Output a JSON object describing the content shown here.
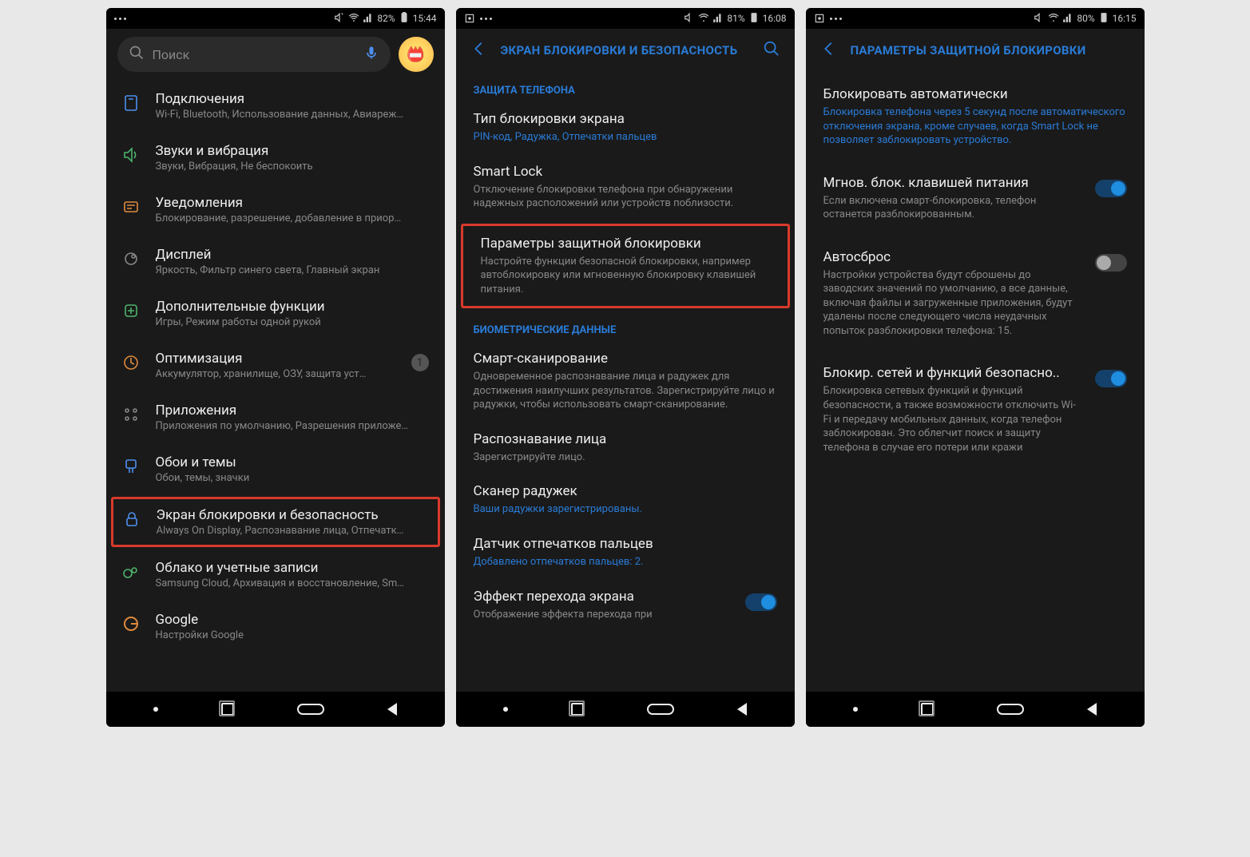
{
  "screen1": {
    "status": {
      "battery": "82%",
      "time": "15:44"
    },
    "search_placeholder": "Поиск",
    "items": [
      {
        "title": "Подключения",
        "sub": "Wi-Fi, Bluetooth, Использование данных, Авиареж…"
      },
      {
        "title": "Звуки и вибрация",
        "sub": "Звуки, Вибрация, Не беспокоить"
      },
      {
        "title": "Уведомления",
        "sub": "Блокирование, разрешение, добавление в приор…"
      },
      {
        "title": "Дисплей",
        "sub": "Яркость, Фильтр синего света, Главный экран"
      },
      {
        "title": "Дополнительные функции",
        "sub": "Игры, Режим работы одной рукой"
      },
      {
        "title": "Оптимизация",
        "sub": "Аккумулятор, хранилище, ОЗУ, защита уст…",
        "badge": "1"
      },
      {
        "title": "Приложения",
        "sub": "Приложения по умолчанию, Разрешения приложе…"
      },
      {
        "title": "Обои и темы",
        "sub": "Обои, темы, значки"
      },
      {
        "title": "Экран блокировки и безопасность",
        "sub": "Always On Display, Распознавание лица, Отпечатк…",
        "highlighted": true
      },
      {
        "title": "Облако и учетные записи",
        "sub": "Samsung Cloud, Архивация и восстановление, Sm…"
      },
      {
        "title": "Google",
        "sub": "Настройки Google"
      }
    ]
  },
  "screen2": {
    "status": {
      "battery": "81%",
      "time": "16:08"
    },
    "header": "ЭКРАН БЛОКИРОВКИ И БЕЗОПАСНОСТЬ",
    "section1": "ЗАЩИТА ТЕЛЕФОНА",
    "items1": [
      {
        "title": "Тип блокировки экрана",
        "sub": "PIN-код, Радужка, Отпечатки пальцев",
        "blue": true
      },
      {
        "title": "Smart Lock",
        "sub": "Отключение блокировки телефона при обнаружении надежных расположений или устройств поблизости."
      },
      {
        "title": "Параметры защитной блокировки",
        "sub": "Настройте функции безопасной блокировки, например автоблокировку или мгновенную блокировку клавишей питания.",
        "highlighted": true
      }
    ],
    "section2": "БИОМЕТРИЧЕСКИЕ ДАННЫЕ",
    "items2": [
      {
        "title": "Смарт-сканирование",
        "sub": "Одновременное распознавание лица и радужек для достижения наилучших результатов. Зарегистрируйте лицо и радужки, чтобы использовать смарт-сканирование."
      },
      {
        "title": "Распознавание лица",
        "sub": "Зарегистрируйте лицо."
      },
      {
        "title": "Сканер радужек",
        "sub": "Ваши радужки зарегистрированы.",
        "blue": true
      },
      {
        "title": "Датчик отпечатков пальцев",
        "sub": "Добавлено отпечатков пальцев: 2.",
        "blue": true
      },
      {
        "title": "Эффект перехода экрана",
        "sub": "Отображение эффекта перехода при",
        "toggle": true,
        "on": true
      }
    ]
  },
  "screen3": {
    "status": {
      "battery": "80%",
      "time": "16:15"
    },
    "header": "ПАРАМЕТРЫ ЗАЩИТНОЙ БЛОКИРОВКИ",
    "items": [
      {
        "title": "Блокировать автоматически",
        "sub": "Блокировка телефона через 5 секунд после автоматического отключения экрана, кроме случаев, когда Smart Lock не позволяет заблокировать устройство.",
        "blue": true
      },
      {
        "title": "Мгнов. блок. клавишей питания",
        "sub": "Если включена смарт-блокировка, телефон останется разблокированным.",
        "toggle": true,
        "on": true
      },
      {
        "title": "Автосброс",
        "sub": "Настройки устройства будут сброшены до заводских значений по умолчанию, а все данные, включая файлы и загруженные приложения, будут удалены после следующего числа неудачных попыток разблокировки телефона: 15.",
        "toggle": true,
        "on": false
      },
      {
        "title": "Блокир. сетей и функций безопасно..",
        "sub": "Блокировка сетевых функций и функций безопасности, а также возможности отключить Wi-Fi и передачу мобильных данных, когда телефон заблокирован. Это облегчит поиск и защиту телефона в случае его потери или кражи",
        "toggle": true,
        "on": true
      }
    ]
  }
}
